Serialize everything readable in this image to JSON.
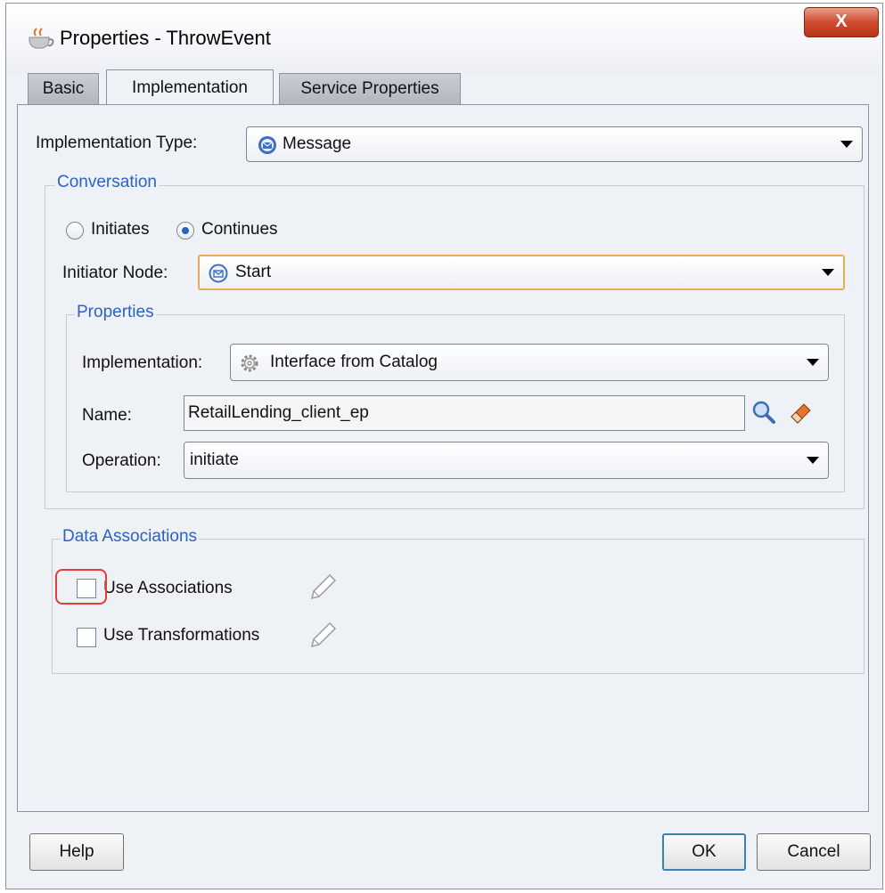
{
  "window": {
    "title": "Properties - ThrowEvent",
    "close_label": "X"
  },
  "tabs": [
    {
      "label": "Basic",
      "selected": false
    },
    {
      "label": "Implementation",
      "selected": true
    },
    {
      "label": "Service Properties",
      "selected": false
    }
  ],
  "implementation_type": {
    "label": "Implementation Type:",
    "value": "Message",
    "icon": "message-icon"
  },
  "conversation": {
    "title": "Conversation",
    "initiates_label": "Initiates",
    "continues_label": "Continues",
    "selected": "Continues",
    "initiator_node_label": "Initiator Node:",
    "initiator_node_value": "Start"
  },
  "properties": {
    "title": "Properties",
    "implementation_label": "Implementation:",
    "implementation_value": "Interface from Catalog",
    "name_label": "Name:",
    "name_value": "RetailLending_client_ep",
    "operation_label": "Operation:",
    "operation_value": "initiate"
  },
  "data_associations": {
    "title": "Data Associations",
    "use_associations_label": "Use Associations",
    "use_associations_checked": false,
    "use_transformations_label": "Use Transformations",
    "use_transformations_checked": false
  },
  "footer": {
    "help_label": "Help",
    "ok_label": "OK",
    "cancel_label": "Cancel"
  },
  "colors": {
    "group_title": "#2b63c2",
    "focus_border": "#e6ac55",
    "highlight": "#e43b3b",
    "close_button": "#cf4c2f"
  }
}
